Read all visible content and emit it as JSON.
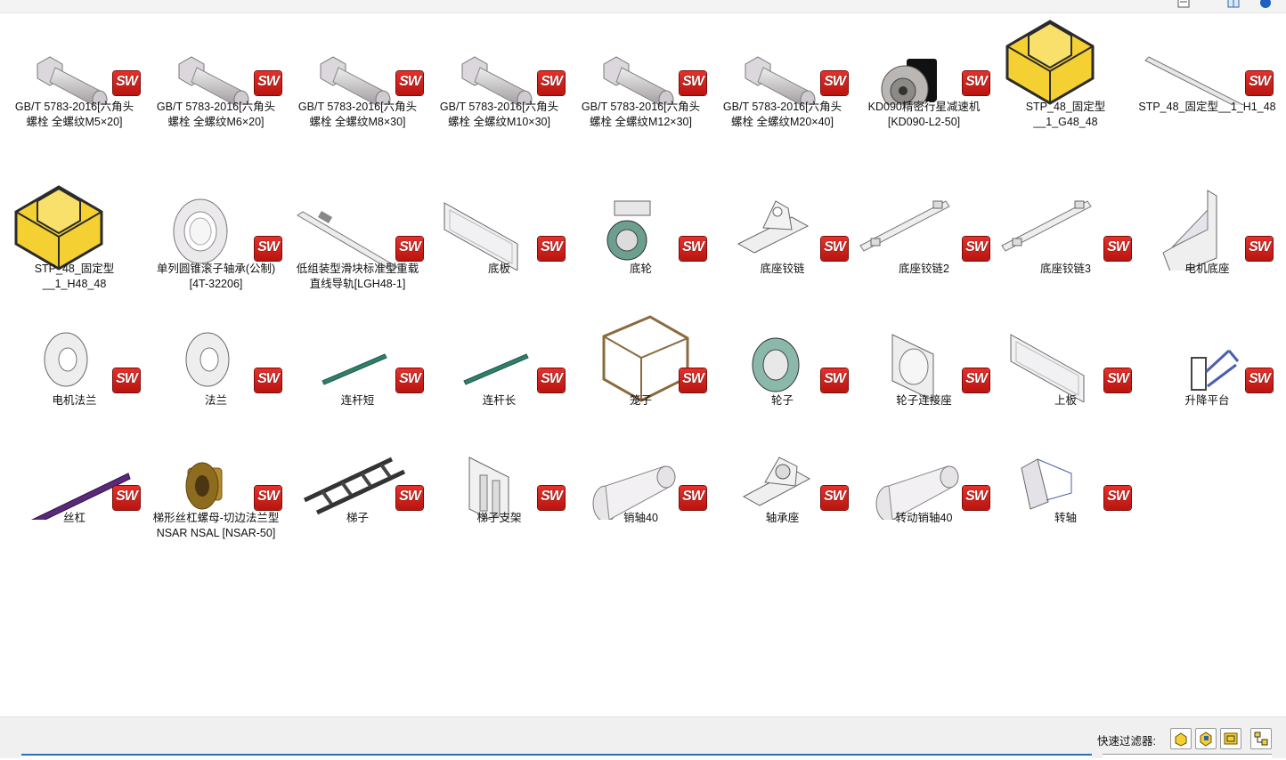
{
  "topbar": {
    "icons": [
      "view-icon",
      "layout-icon",
      "help-icon"
    ]
  },
  "items": [
    {
      "label": "GB/T 5783-2016[六角头\n螺栓 全螺纹M5×20]",
      "icon": "hex-bolt-thumbnail",
      "badge": "SW"
    },
    {
      "label": "GB/T 5783-2016[六角头\n螺栓 全螺纹M6×20]",
      "icon": "hex-bolt-thumbnail",
      "badge": "SW"
    },
    {
      "label": "GB/T 5783-2016[六角头\n螺栓 全螺纹M8×30]",
      "icon": "hex-bolt-thumbnail",
      "badge": "SW"
    },
    {
      "label": "GB/T 5783-2016[六角头\n螺栓 全螺纹M10×30]",
      "icon": "hex-bolt-thumbnail",
      "badge": "SW"
    },
    {
      "label": "GB/T 5783-2016[六角头\n螺栓 全螺纹M12×30]",
      "icon": "hex-bolt-thumbnail",
      "badge": "SW"
    },
    {
      "label": "GB/T 5783-2016[六角头\n螺栓 全螺纹M20×40]",
      "icon": "hex-bolt-thumbnail",
      "badge": "SW"
    },
    {
      "label": "KD090精密行星减速机\n[KD090-L2-50]",
      "icon": "gearbox-thumbnail",
      "badge": "SW"
    },
    {
      "label": "STP_48_固定型\n__1_G48_48",
      "icon": "step-file-icon",
      "badge": ""
    },
    {
      "label": "STP_48_固定型__1_H1_48",
      "icon": "rail-thumbnail",
      "badge": "SW"
    },
    {
      "label": "STP_48_固定型\n__1_H48_48",
      "icon": "step-file-icon",
      "badge": ""
    },
    {
      "label": "单列圆锥滚子轴承(公制)\n[4T-32206]",
      "icon": "bearing-thumbnail",
      "badge": "SW"
    },
    {
      "label": "低组装型滑块标准型重载\n直线导轨[LGH48-1]",
      "icon": "linear-guide-thumbnail",
      "badge": "SW"
    },
    {
      "label": "底板",
      "icon": "plate-thumbnail",
      "badge": "SW"
    },
    {
      "label": "底轮",
      "icon": "caster-thumbnail",
      "badge": "SW"
    },
    {
      "label": "底座铰链",
      "icon": "hinge-base-thumbnail",
      "badge": "SW"
    },
    {
      "label": "底座铰链2",
      "icon": "hinge-bar-thumbnail",
      "badge": "SW"
    },
    {
      "label": "底座铰链3",
      "icon": "hinge-bar-thumbnail",
      "badge": "SW"
    },
    {
      "label": "电机底座",
      "icon": "motor-base-thumbnail",
      "badge": "SW"
    },
    {
      "label": "电机法兰",
      "icon": "flange-thumbnail",
      "badge": "SW"
    },
    {
      "label": "法兰",
      "icon": "flange-thumbnail",
      "badge": "SW"
    },
    {
      "label": "连杆短",
      "icon": "rod-thumbnail",
      "badge": "SW"
    },
    {
      "label": "连杆长",
      "icon": "rod-thumbnail",
      "badge": "SW"
    },
    {
      "label": "笼子",
      "icon": "cage-thumbnail",
      "badge": "SW"
    },
    {
      "label": "轮子",
      "icon": "wheel-thumbnail",
      "badge": "SW"
    },
    {
      "label": "轮子连接座",
      "icon": "wheel-mount-thumbnail",
      "badge": "SW"
    },
    {
      "label": "上板",
      "icon": "plate-thumbnail",
      "badge": "SW"
    },
    {
      "label": "升降平台",
      "icon": "lift-platform-thumbnail",
      "badge": "SW"
    },
    {
      "label": "丝杠",
      "icon": "lead-screw-thumbnail",
      "badge": "SW"
    },
    {
      "label": "梯形丝杠螺母-切边法兰型\nNSAR NSAL [NSAR-50]",
      "icon": "screw-nut-thumbnail",
      "badge": "SW"
    },
    {
      "label": "梯子",
      "icon": "ladder-thumbnail",
      "badge": "SW"
    },
    {
      "label": "梯子支架",
      "icon": "ladder-bracket-thumbnail",
      "badge": "SW"
    },
    {
      "label": "销轴40",
      "icon": "pin-thumbnail",
      "badge": "SW"
    },
    {
      "label": "轴承座",
      "icon": "bearing-block-thumbnail",
      "badge": "SW"
    },
    {
      "label": "转动销轴40",
      "icon": "pin-thumbnail",
      "badge": "SW"
    },
    {
      "label": "转轴",
      "icon": "shaft-thumbnail",
      "badge": "SW"
    }
  ],
  "quick_filter": {
    "label": "快速过滤器:",
    "buttons": [
      "filter-parts-icon",
      "filter-assemblies-icon",
      "filter-drawings-icon",
      "filter-top-level-icon"
    ]
  },
  "colors": {
    "sw_badge": "#d9231d",
    "step_icon": "#f5d033",
    "selection_bar": "#2a6fb8"
  }
}
